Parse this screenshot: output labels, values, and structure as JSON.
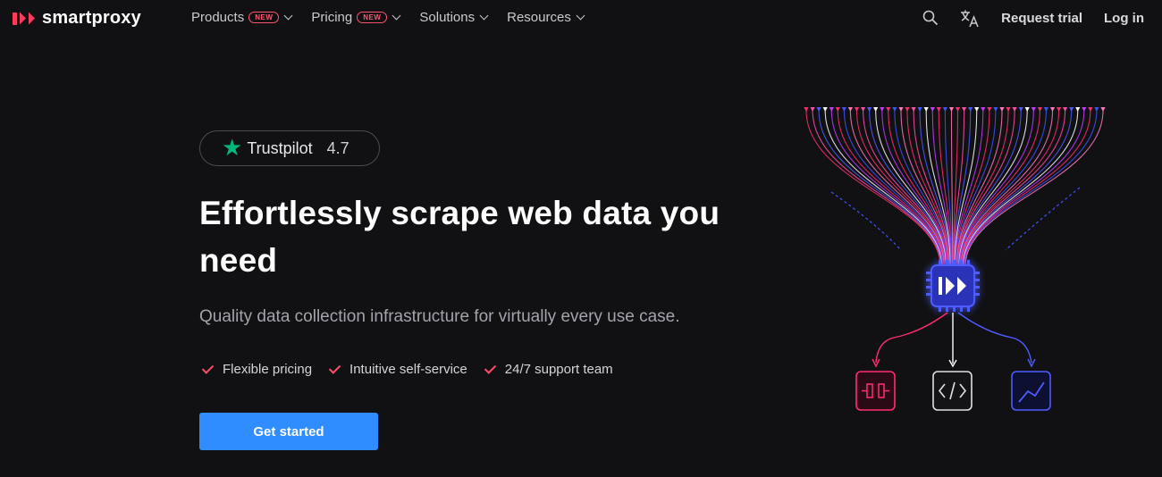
{
  "brand": {
    "name": "smartproxy"
  },
  "nav": {
    "items": [
      {
        "label": "Products",
        "badge": "NEW"
      },
      {
        "label": "Pricing",
        "badge": "NEW"
      },
      {
        "label": "Solutions"
      },
      {
        "label": "Resources"
      }
    ],
    "request_trial": "Request trial",
    "login": "Log in"
  },
  "hero": {
    "trustpilot": {
      "name": "Trustpilot",
      "score": "4.7"
    },
    "title": "Effortlessly scrape web data you need",
    "subtitle": "Quality data collection infrastructure for virtually every use case.",
    "features": [
      "Flexible pricing",
      "Intuitive self-service",
      "24/7 support team"
    ],
    "cta": "Get started"
  },
  "colors": {
    "background": "#111113",
    "accent": "#ff3b5c",
    "cta": "#2f8dff",
    "trustpilot_green": "#00b67a"
  },
  "icons": [
    "search-icon",
    "translate-icon",
    "chevron-down-icon",
    "check-icon",
    "plug-icon",
    "code-icon",
    "chart-icon",
    "chip-icon"
  ]
}
